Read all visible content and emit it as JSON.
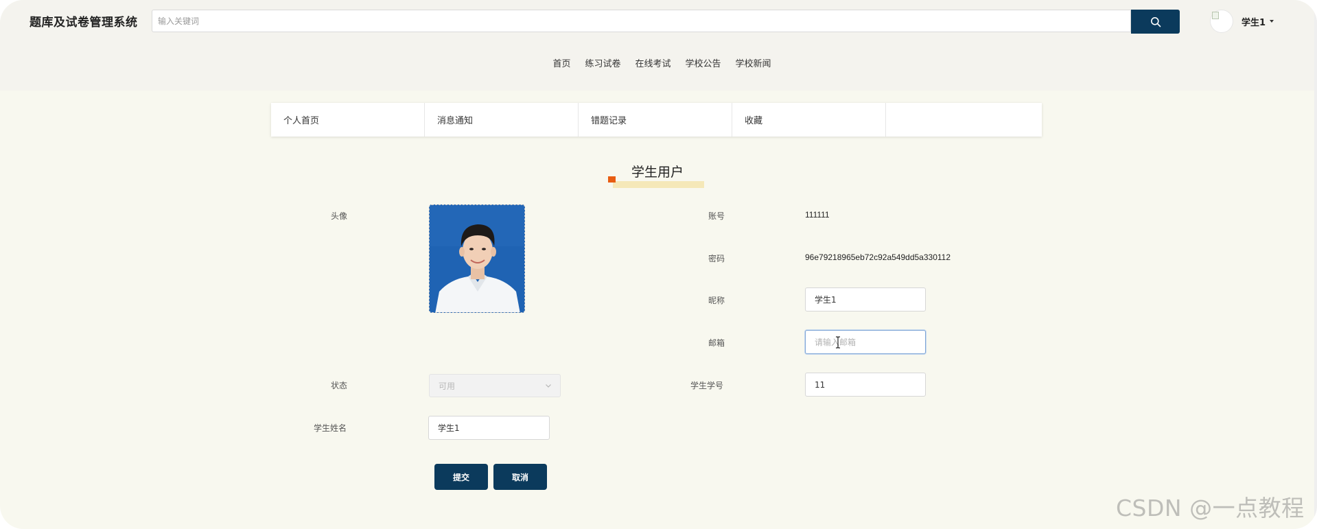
{
  "header": {
    "brand": "题库及试卷管理系统",
    "search_placeholder": "输入关键词",
    "user_name": "学生1"
  },
  "main_nav": [
    "首页",
    "练习试卷",
    "在线考试",
    "学校公告",
    "学校新闻"
  ],
  "sub_nav": [
    "个人首页",
    "消息通知",
    "错题记录",
    "收藏"
  ],
  "section_title": "学生用户",
  "form": {
    "avatar_label": "头像",
    "account_label": "账号",
    "account_value": "111111",
    "password_label": "密码",
    "password_value": "96e79218965eb72c92a549dd5a330112",
    "nickname_label": "昵称",
    "nickname_value": "学生1",
    "email_label": "邮箱",
    "email_placeholder": "请输入邮箱",
    "status_label": "状态",
    "status_value": "可用",
    "student_no_label": "学生学号",
    "student_no_value": "11",
    "student_name_label": "学生姓名",
    "student_name_value": "学生1"
  },
  "buttons": {
    "submit": "提交",
    "cancel": "取消"
  },
  "watermark": "CSDN @一点教程",
  "colors": {
    "primary": "#0b3a5c",
    "page_bg": "#f8f8ef",
    "header_bg": "#f4f3ee",
    "title_accent": "#e85d12",
    "title_underline": "#f5e8b8"
  }
}
